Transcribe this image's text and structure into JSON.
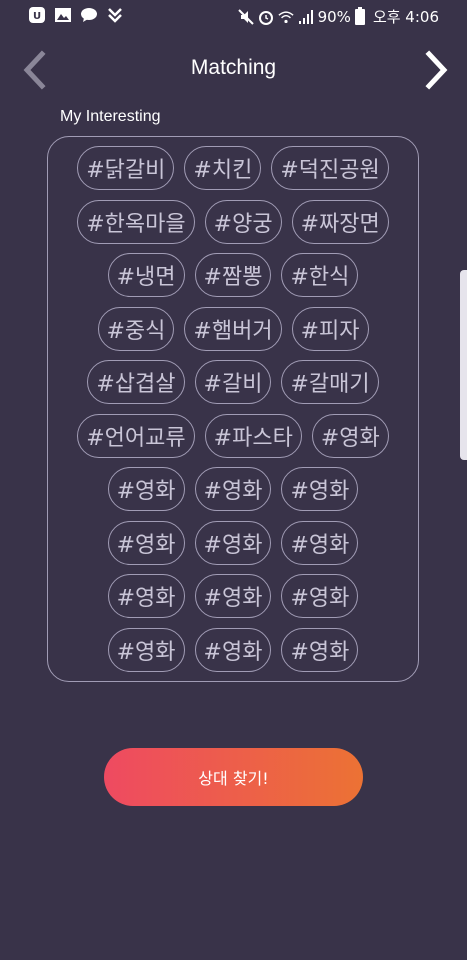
{
  "status_bar": {
    "left_icons": [
      "app-notification-icon",
      "gallery-icon",
      "kakaotalk-icon",
      "download-icon"
    ],
    "right_icons": [
      "mute-icon",
      "alarm-icon",
      "wifi-icon",
      "signal-icon",
      "battery-icon"
    ],
    "battery_percent": "90%",
    "time": "오후 4:06"
  },
  "header": {
    "title": "Matching",
    "back_icon": "chevron-left-icon",
    "forward_icon": "chevron-right-icon"
  },
  "interests": {
    "label": "My Interesting",
    "rows": [
      [
        "#닭갈비",
        "#치킨",
        "#덕진공원"
      ],
      [
        "#한옥마을",
        "#양궁",
        "#짜장면"
      ],
      [
        "#냉면",
        "#짬뽕",
        "#한식"
      ],
      [
        "#중식",
        "#햄버거",
        "#피자"
      ],
      [
        "#삽겹살",
        "#갈비",
        "#갈매기"
      ],
      [
        "#언어교류",
        "#파스타",
        "#영화"
      ],
      [
        "#영화",
        "#영화",
        "#영화"
      ],
      [
        "#영화",
        "#영화",
        "#영화"
      ],
      [
        "#영화",
        "#영화",
        "#영화"
      ],
      [
        "#영화",
        "#영화",
        "#영화"
      ]
    ]
  },
  "find_button": {
    "label": "상대 찾기!"
  },
  "colors": {
    "background": "#393349",
    "tag_border": "#a19cb5",
    "tag_text": "#c9c5d7",
    "button_gradient_start": "#ee4a61",
    "button_gradient_end": "#ec7234"
  }
}
